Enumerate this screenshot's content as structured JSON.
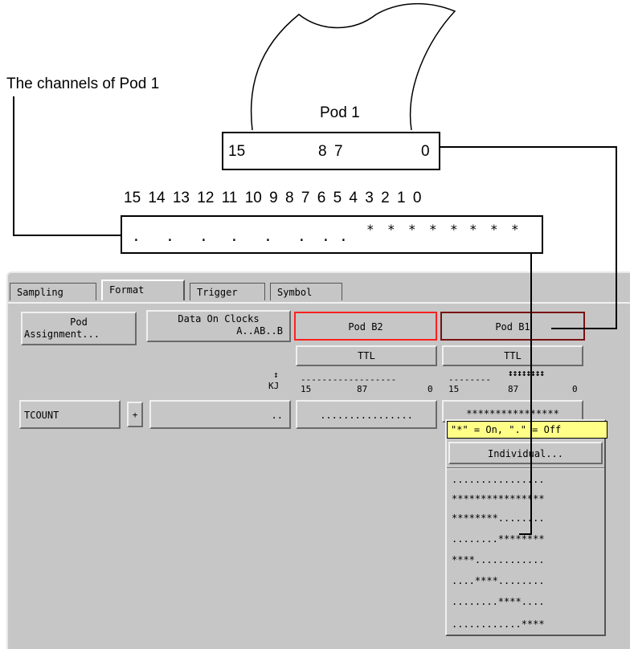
{
  "callouts": {
    "channels_label": "The channels of Pod 1",
    "pod_label": "Pod 1",
    "pod_bits": {
      "b15": "15",
      "b8": "8",
      "b7": "7",
      "b0": "0"
    },
    "channel_numbers": [
      "15",
      "14",
      "13",
      "12",
      "11",
      "10",
      "9",
      "8",
      "7",
      "6",
      "5",
      "4",
      "3",
      "2",
      "1",
      "0"
    ],
    "channel_marks": [
      ".",
      ".",
      ".",
      ".",
      ".",
      ".",
      ".",
      ".",
      "*",
      "*",
      "*",
      "*",
      "*",
      "*",
      "*",
      "*"
    ]
  },
  "tabs": [
    {
      "label": "Sampling",
      "active": false
    },
    {
      "label": "Format",
      "active": true
    },
    {
      "label": "Trigger",
      "active": false
    },
    {
      "label": "Symbol",
      "active": false
    }
  ],
  "buttons": {
    "pod_assignment": [
      "Pod",
      "Assignment..."
    ],
    "data_on_clocks": [
      "Data On Clocks",
      "A..AB..B"
    ],
    "pod_b2": "Pod B2",
    "pod_b1": "Pod B1",
    "ttl_b2": "TTL",
    "ttl_b1": "TTL"
  },
  "headers": {
    "clock_arrow": "↕",
    "clock_kj": "KJ",
    "b2_dashes": "------------------",
    "b2_15": "15",
    "b2_87": "87",
    "b2_0": "0",
    "b1_dashes": "--------",
    "b1_arrows": "↕↕↕↕↕↕↕↕",
    "b1_15": "15",
    "b1_87": "87",
    "b1_0": "0"
  },
  "row": {
    "label": "TCOUNT",
    "plus": "+",
    "clock_value": "..",
    "b2_value": "................",
    "b1_value": "****************"
  },
  "popup": {
    "tooltip": "\"*\" = On, \".\" = Off",
    "individual": "Individual...",
    "items": [
      "................",
      "****************",
      "********........",
      "........********",
      "****............",
      "....****........",
      "........****....",
      "............****"
    ]
  }
}
